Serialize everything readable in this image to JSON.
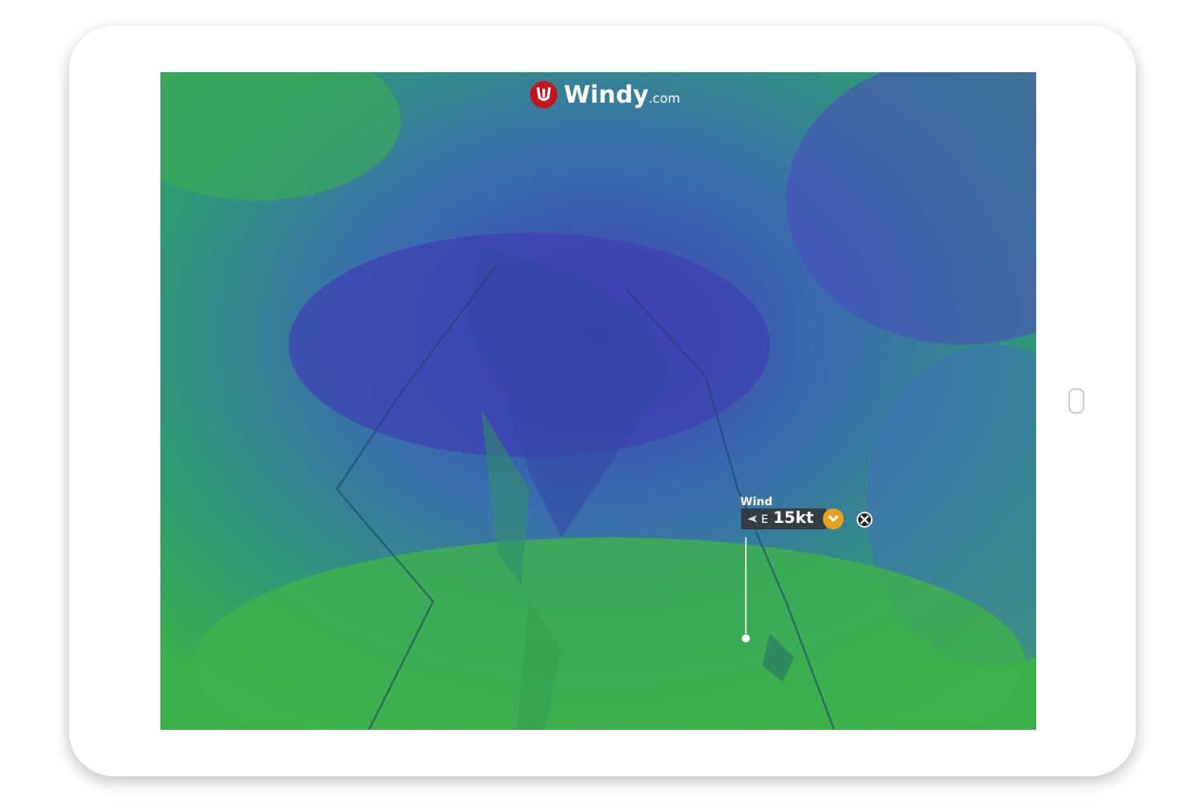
{
  "brand": {
    "name": "Windy",
    "suffix": ".com"
  },
  "picker": {
    "label": "Wind",
    "direction": "E",
    "speed": "15kt"
  }
}
